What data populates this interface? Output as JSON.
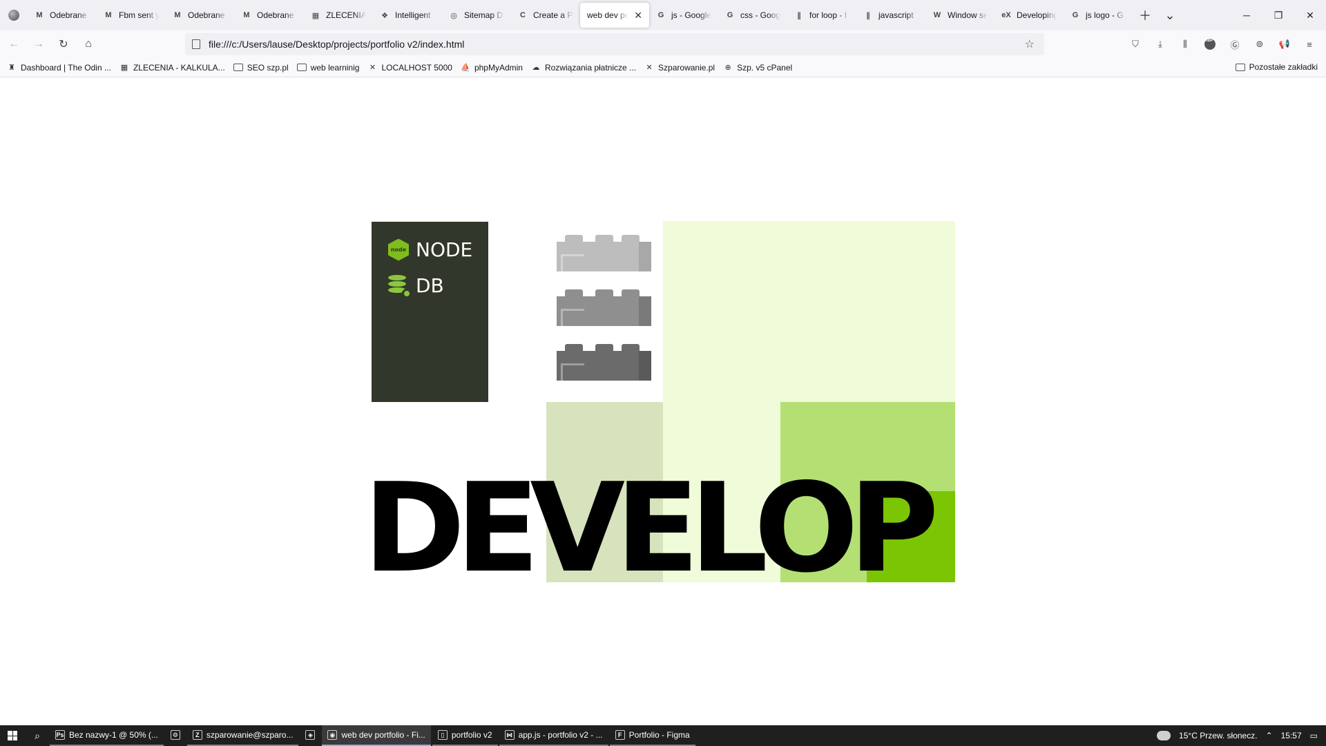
{
  "browser": {
    "tabs": [
      {
        "label": "Odebrane",
        "icon": "gmail-icon",
        "glyph": "M",
        "active": false
      },
      {
        "label": "Fbm sent y",
        "icon": "gmail-icon",
        "glyph": "M",
        "active": false
      },
      {
        "label": "Odebrane",
        "icon": "gmail-icon",
        "glyph": "M",
        "active": false
      },
      {
        "label": "Odebrane",
        "icon": "gmail-icon",
        "glyph": "M",
        "active": false
      },
      {
        "label": "ZLECENIA",
        "icon": "zlecenia-icon",
        "glyph": "▦",
        "active": false
      },
      {
        "label": "Intelligent",
        "icon": "intelligent-icon",
        "glyph": "❖",
        "active": false
      },
      {
        "label": "Sitemap D",
        "icon": "globe-icon",
        "glyph": "◎",
        "active": false
      },
      {
        "label": "Create a P",
        "icon": "create-icon",
        "glyph": "C",
        "active": false
      },
      {
        "label": "web dev por",
        "icon": "",
        "glyph": "",
        "active": true
      },
      {
        "label": "js - Google",
        "icon": "google-icon",
        "glyph": "G",
        "active": false
      },
      {
        "label": "css - Goog",
        "icon": "google-icon",
        "glyph": "G",
        "active": false
      },
      {
        "label": "for loop - I",
        "icon": "mdn-icon",
        "glyph": "∥",
        "active": false
      },
      {
        "label": "javascript",
        "icon": "mdn-icon",
        "glyph": "∥",
        "active": false
      },
      {
        "label": "Window se",
        "icon": "w3-icon",
        "glyph": "W",
        "active": false
      },
      {
        "label": "Developing",
        "icon": "ex-icon",
        "glyph": "eX",
        "active": false
      },
      {
        "label": "js logo - G",
        "icon": "google-icon",
        "glyph": "G",
        "active": false
      }
    ],
    "url": "file:///c:/Users/lause/Desktop/projects/portfolio v2/index.html",
    "bookmarks": [
      {
        "label": "Dashboard | The Odin ...",
        "icon": "odin-icon",
        "glyph": "♜"
      },
      {
        "label": "ZLECENIA - KALKULA...",
        "icon": "zlecenia-icon",
        "glyph": "▦"
      },
      {
        "label": "SEO szp.pl",
        "icon": "folder-icon",
        "glyph": ""
      },
      {
        "label": "web learninig",
        "icon": "folder-icon",
        "glyph": ""
      },
      {
        "label": "LOCALHOST 5000",
        "icon": "szp-icon",
        "glyph": "✕"
      },
      {
        "label": "phpMyAdmin",
        "icon": "phpmyadmin-icon",
        "glyph": "⛵"
      },
      {
        "label": "Rozwiązania płatnicze ...",
        "icon": "payments-icon",
        "glyph": "☁"
      },
      {
        "label": "Szparowanie.pl",
        "icon": "szp-icon",
        "glyph": "✕"
      },
      {
        "label": "Szp. v5 cPanel",
        "icon": "globe-icon",
        "glyph": "⊕"
      }
    ],
    "other_bookmarks": "Pozostałe zakładki"
  },
  "page": {
    "tech": [
      {
        "label": "NODE",
        "icon": "nodejs-icon"
      },
      {
        "label": "DB",
        "icon": "database-icon"
      }
    ],
    "headline": "DEVELOP",
    "bricks": [
      {
        "color": "#bdbdbd",
        "shade": "#a8a8a8"
      },
      {
        "color": "#8f8f8f",
        "shade": "#7a7a7a"
      },
      {
        "color": "#6b6b6b",
        "shade": "#5a5a5a"
      }
    ],
    "colors": {
      "dark": "#31372a",
      "pale": "#effbd9",
      "sage": "#d7e3bd",
      "lime": "#b4e073",
      "green": "#7cc504"
    }
  },
  "taskbar": {
    "apps": [
      {
        "label": "Bez nazwy-1 @ 50% (...",
        "icon": "photoshop-icon",
        "glyph": "Ps"
      },
      {
        "label": "",
        "icon": "settings-icon",
        "glyph": "⚙"
      },
      {
        "label": "szparowanie@szparo...",
        "icon": "filezilla-icon",
        "glyph": "Z"
      },
      {
        "label": "",
        "icon": "brave-icon",
        "glyph": "◈"
      },
      {
        "label": "web dev portfolio - Fi...",
        "icon": "firefox-icon",
        "glyph": "◉"
      },
      {
        "label": "portfolio v2",
        "icon": "file-icon",
        "glyph": "▯"
      },
      {
        "label": "app.js - portfolio v2 - ...",
        "icon": "vscode-icon",
        "glyph": "⋈"
      },
      {
        "label": "Portfolio - Figma",
        "icon": "figma-icon",
        "glyph": "F"
      }
    ],
    "weather": "15°C  Przew. słonecz.",
    "time": "15:57"
  }
}
